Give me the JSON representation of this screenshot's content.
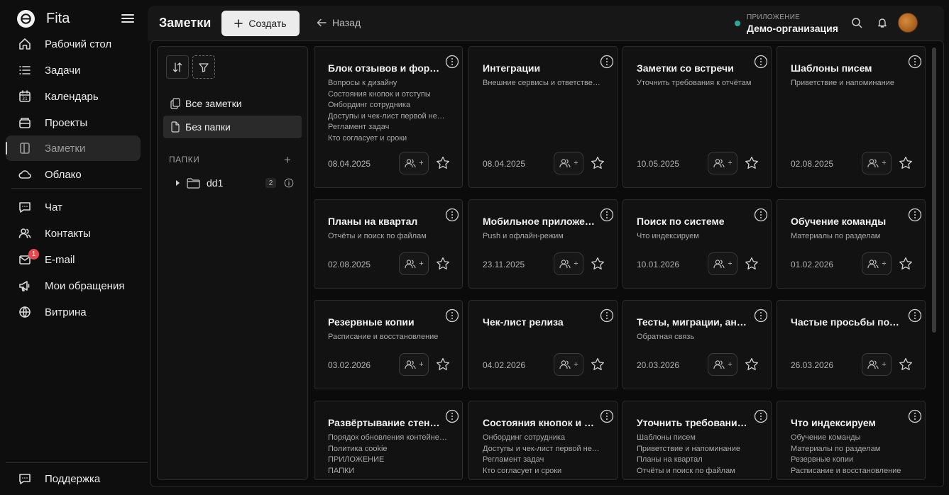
{
  "app": {
    "name": "Fita"
  },
  "sidebar": {
    "items": [
      {
        "label": "Рабочий стол",
        "icon": "home-icon"
      },
      {
        "label": "Задачи",
        "icon": "list-icon"
      },
      {
        "label": "Календарь",
        "icon": "calendar-icon"
      },
      {
        "label": "Проекты",
        "icon": "projects-icon"
      },
      {
        "label": "Заметки",
        "icon": "notes-icon",
        "active": true
      },
      {
        "label": "Облако",
        "icon": "cloud-icon"
      },
      {
        "label": "Чат",
        "icon": "chat-icon"
      },
      {
        "label": "Контакты",
        "icon": "contacts-icon"
      },
      {
        "label": "E-mail",
        "icon": "mail-icon",
        "badge": "1"
      },
      {
        "label": "Мои обращения",
        "icon": "megaphone-icon"
      },
      {
        "label": "Витрина",
        "icon": "globe-icon"
      }
    ],
    "support_label": "Поддержка"
  },
  "header": {
    "title": "Заметки",
    "create_label": "Создать",
    "back_label": "Назад",
    "org_label": "ПРИЛОЖЕНИЕ",
    "org_name": "Демо-организация",
    "org_status_color": "#2aa79b"
  },
  "folders": {
    "all_notes": "Все заметки",
    "no_folder": "Без папки",
    "section_label": "ПАПКИ",
    "add_label": "+",
    "list": [
      {
        "name": "dd1",
        "count": "2"
      }
    ]
  },
  "cards": [
    {
      "title": "Блок отзывов и формы",
      "lines": [
        "Вопросы к дизайну",
        "Состояния кнопок и отступы",
        "Онбординг сотрудника",
        "Доступы и чек-лист первой недели",
        "Регламент задач",
        "Кто согласует и сроки"
      ],
      "date": "08.04.2025"
    },
    {
      "title": "Интеграции",
      "lines": [
        "Внешние сервисы и ответственные"
      ],
      "date": "08.04.2025"
    },
    {
      "title": "Заметки со встречи",
      "lines": [
        "Уточнить требования к отчётам"
      ],
      "date": "10.05.2025"
    },
    {
      "title": "Шаблоны писем",
      "lines": [
        "Приветствие и напоминание"
      ],
      "date": "02.08.2025"
    },
    {
      "title": "Планы на квартал",
      "lines": [
        "Отчёты и поиск по файлам"
      ],
      "date": "02.08.2025"
    },
    {
      "title": "Мобильное приложение",
      "lines": [
        "Push и офлайн-режим"
      ],
      "date": "23.11.2025"
    },
    {
      "title": "Поиск по системе",
      "lines": [
        "Что индексируем"
      ],
      "date": "10.01.2026"
    },
    {
      "title": "Обучение команды",
      "lines": [
        "Материалы по разделам"
      ],
      "date": "01.02.2026"
    },
    {
      "title": "Резервные копии",
      "lines": [
        "Расписание и восстановление"
      ],
      "date": "03.02.2026"
    },
    {
      "title": "Чек-лист релиза",
      "lines": [],
      "date": "04.02.2026"
    },
    {
      "title": "Тесты, миграции, анонсы",
      "lines": [
        "Обратная связь"
      ],
      "date": "20.03.2026"
    },
    {
      "title": "Частые просьбы пользователей",
      "lines": [],
      "date": "26.03.2026"
    },
    {
      "title": "Развёртывание стенда",
      "lines": [
        "Порядок обновления контейнеров",
        "Политика cookie",
        "ПРИЛОЖЕНИЕ",
        "ПАПКИ"
      ],
      "date": ""
    },
    {
      "title": "Состояния кнопок и отступы",
      "lines": [
        "Онбординг сотрудника",
        "Доступы и чек-лист первой недели",
        "Регламент задач",
        "Кто согласует и сроки"
      ],
      "date": ""
    },
    {
      "title": "Уточнить требования к отчётам",
      "lines": [
        "Шаблоны писем",
        "Приветствие и напоминание",
        "Планы на квартал",
        "Отчёты и поиск по файлам"
      ],
      "date": ""
    },
    {
      "title": "Что индексируем",
      "lines": [
        "Обучение команды",
        "Материалы по разделам",
        "Резервные копии",
        "Расписание и восстановление"
      ],
      "date": ""
    }
  ]
}
